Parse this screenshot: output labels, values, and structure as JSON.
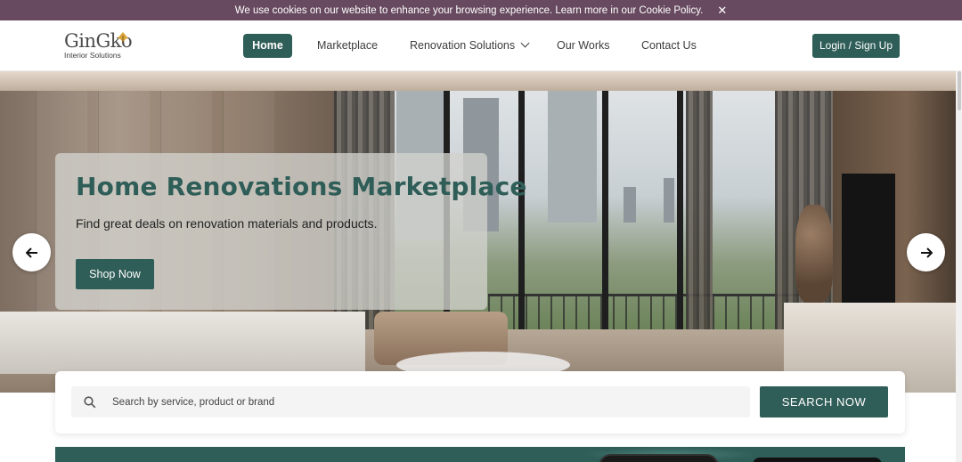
{
  "cookie": {
    "text": "We use cookies on our website to enhance your browsing experience. Learn more in our Cookie Policy.",
    "close_icon": "✕"
  },
  "brand": {
    "name": "GinGko",
    "tagline": "Interior Solutions",
    "accent": "#2f5d57",
    "leaf_color": "#d9a53c"
  },
  "nav": {
    "home": "Home",
    "marketplace": "Marketplace",
    "renovation": "Renovation Solutions",
    "works": "Our Works",
    "contact": "Contact Us",
    "login": "Login / Sign Up"
  },
  "hero": {
    "title": "Home Renovations Marketplace",
    "subtitle": "Find great deals on renovation materials and products.",
    "cta": "Shop Now",
    "prev_icon": "arrow-left-icon",
    "next_icon": "arrow-right-icon"
  },
  "search": {
    "placeholder": "Search by service, product or brand",
    "value": "",
    "button": "SEARCH NOW"
  }
}
